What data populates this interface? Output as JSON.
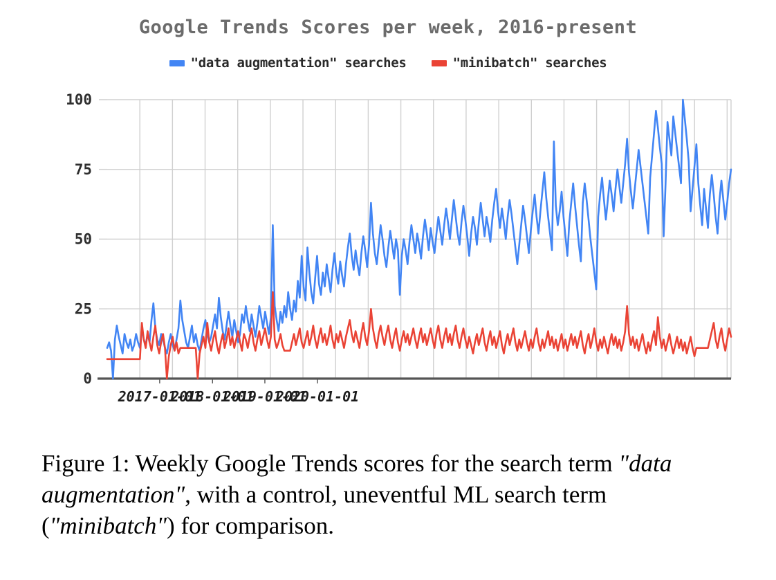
{
  "figure": {
    "caption_prefix": "Figure 1:",
    "caption_part1": " Weekly Google Trends scores for the search term ",
    "caption_em1": "\"data augmentation\"",
    "caption_part2": ", with a control, uneventful ML search term (",
    "caption_em2": "\"minibatch\"",
    "caption_part3": ") for comparison."
  },
  "colors": {
    "series_blue": "#4285f4",
    "series_red": "#ea4335",
    "title": "#6b6b6b",
    "gridline": "#d0d0d0",
    "axis": "#555555",
    "tick_label": "#2f2f2f"
  },
  "chart_data": {
    "type": "line",
    "title": "Google Trends Scores per week, 2016-present",
    "xlabel": "",
    "ylabel": "",
    "ylim": [
      0,
      100
    ],
    "yticks": [
      0,
      25,
      50,
      75,
      100
    ],
    "xticks": [
      "2017-01-01",
      "2018-01-01",
      "2019-01-01",
      "2020-01-01"
    ],
    "xtick_positions_frac": [
      0.402,
      0.807,
      1.208,
      1.611
    ],
    "xlim_years": [
      2016.0,
      2020.78
    ],
    "grid": true,
    "grid_axis": "both",
    "legend_position": "top-center",
    "x_unit": "week",
    "series": [
      {
        "name": "\"data augmentation\" searches",
        "color": "#4285f4",
        "values": [
          11,
          13,
          10,
          0,
          14,
          19,
          15,
          12,
          9,
          16,
          13,
          11,
          14,
          10,
          12,
          16,
          13,
          11,
          18,
          14,
          12,
          16,
          13,
          21,
          27,
          18,
          14,
          12,
          16,
          14,
          11,
          9,
          13,
          16,
          12,
          10,
          14,
          18,
          28,
          21,
          17,
          13,
          11,
          15,
          19,
          13,
          16,
          12,
          10,
          14,
          18,
          21,
          16,
          13,
          15,
          19,
          23,
          18,
          29,
          22,
          17,
          14,
          19,
          24,
          19,
          15,
          21,
          17,
          13,
          16,
          23,
          20,
          26,
          21,
          17,
          23,
          19,
          15,
          20,
          26,
          22,
          18,
          24,
          20,
          16,
          22,
          55,
          26,
          21,
          17,
          24,
          20,
          26,
          22,
          31,
          25,
          21,
          28,
          24,
          35,
          29,
          44,
          33,
          28,
          47,
          38,
          31,
          27,
          36,
          44,
          34,
          30,
          38,
          33,
          41,
          36,
          31,
          39,
          45,
          38,
          34,
          42,
          37,
          33,
          41,
          47,
          52,
          44,
          39,
          46,
          41,
          37,
          45,
          51,
          46,
          40,
          48,
          63,
          52,
          45,
          41,
          48,
          55,
          50,
          44,
          40,
          47,
          53,
          48,
          43,
          50,
          46,
          30,
          44,
          50,
          46,
          41,
          49,
          55,
          50,
          45,
          52,
          48,
          43,
          51,
          57,
          52,
          46,
          54,
          49,
          45,
          52,
          58,
          53,
          48,
          55,
          61,
          56,
          50,
          57,
          64,
          58,
          52,
          48,
          56,
          62,
          57,
          51,
          44,
          52,
          58,
          54,
          48,
          56,
          63,
          57,
          51,
          58,
          54,
          49,
          57,
          63,
          68,
          60,
          54,
          61,
          56,
          50,
          58,
          64,
          59,
          53,
          47,
          41,
          48,
          55,
          62,
          57,
          51,
          45,
          53,
          60,
          66,
          58,
          52,
          60,
          67,
          74,
          65,
          58,
          52,
          46,
          85,
          62,
          55,
          60,
          67,
          58,
          51,
          44,
          56,
          63,
          70,
          62,
          55,
          48,
          42,
          63,
          70,
          64,
          57,
          50,
          44,
          38,
          32,
          58,
          66,
          72,
          64,
          57,
          64,
          71,
          66,
          60,
          68,
          75,
          69,
          63,
          70,
          77,
          86,
          74,
          67,
          61,
          68,
          75,
          82,
          76,
          70,
          64,
          58,
          52,
          72,
          80,
          88,
          96,
          90,
          83,
          77,
          51,
          70,
          92,
          86,
          80,
          94,
          88,
          82,
          76,
          70,
          100,
          93,
          86,
          78,
          60,
          68,
          76,
          84,
          70,
          62,
          55,
          68,
          61,
          54,
          66,
          73,
          66,
          58,
          52,
          64,
          71,
          64,
          57,
          63,
          70,
          75
        ]
      },
      {
        "name": "\"minibatch\" searches",
        "color": "#ea4335",
        "values": [
          7,
          7,
          7,
          7,
          7,
          7,
          7,
          7,
          7,
          7,
          7,
          7,
          7,
          7,
          7,
          7,
          7,
          7,
          20,
          14,
          11,
          17,
          13,
          10,
          15,
          19,
          12,
          9,
          13,
          16,
          11,
          0,
          8,
          12,
          15,
          10,
          13,
          9,
          11,
          11,
          11,
          11,
          11,
          11,
          11,
          11,
          11,
          0,
          9,
          12,
          15,
          11,
          20,
          13,
          10,
          14,
          17,
          12,
          9,
          13,
          16,
          11,
          14,
          18,
          12,
          15,
          11,
          14,
          17,
          13,
          10,
          16,
          14,
          11,
          15,
          18,
          13,
          10,
          14,
          17,
          12,
          15,
          18,
          14,
          11,
          15,
          31,
          14,
          11,
          13,
          16,
          12,
          10,
          10,
          10,
          10,
          13,
          16,
          12,
          15,
          18,
          13,
          11,
          14,
          17,
          12,
          15,
          19,
          14,
          11,
          15,
          18,
          13,
          16,
          12,
          15,
          19,
          14,
          11,
          16,
          13,
          17,
          14,
          11,
          15,
          18,
          21,
          16,
          13,
          17,
          14,
          11,
          16,
          20,
          15,
          12,
          17,
          25,
          18,
          14,
          11,
          16,
          19,
          15,
          12,
          16,
          19,
          14,
          11,
          15,
          18,
          13,
          10,
          14,
          17,
          13,
          16,
          12,
          15,
          18,
          14,
          11,
          15,
          18,
          13,
          16,
          12,
          15,
          18,
          14,
          11,
          16,
          19,
          14,
          11,
          15,
          18,
          13,
          16,
          12,
          16,
          19,
          14,
          11,
          15,
          18,
          14,
          11,
          15,
          12,
          9,
          13,
          16,
          12,
          15,
          18,
          13,
          10,
          14,
          17,
          12,
          15,
          11,
          14,
          17,
          12,
          9,
          13,
          16,
          12,
          15,
          18,
          13,
          10,
          14,
          11,
          14,
          17,
          13,
          10,
          14,
          11,
          15,
          18,
          13,
          10,
          14,
          11,
          14,
          17,
          12,
          15,
          11,
          14,
          10,
          13,
          16,
          11,
          14,
          10,
          13,
          16,
          12,
          15,
          11,
          14,
          17,
          12,
          9,
          13,
          16,
          11,
          14,
          18,
          13,
          10,
          14,
          11,
          15,
          12,
          9,
          13,
          16,
          12,
          15,
          11,
          14,
          10,
          13,
          17,
          26,
          16,
          12,
          15,
          11,
          14,
          10,
          13,
          16,
          12,
          9,
          13,
          10,
          14,
          17,
          12,
          22,
          15,
          11,
          14,
          10,
          13,
          16,
          12,
          9,
          12,
          15,
          11,
          14,
          10,
          13,
          9,
          12,
          15,
          11,
          8,
          11,
          11,
          11,
          11,
          11,
          11,
          11,
          14,
          17,
          20,
          14,
          11,
          15,
          18,
          13,
          10,
          14,
          18,
          15
        ]
      }
    ]
  }
}
